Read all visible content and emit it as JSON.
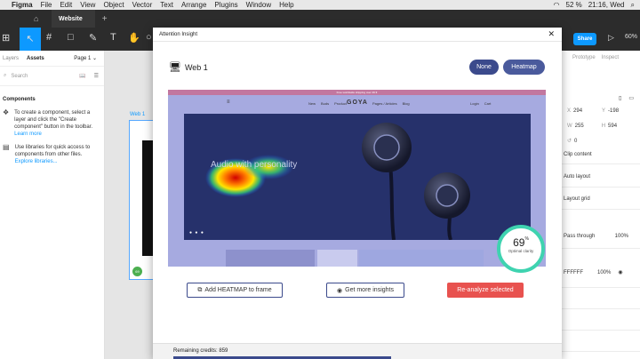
{
  "os": {
    "menus": [
      "Figma",
      "File",
      "Edit",
      "View",
      "Object",
      "Vector",
      "Text",
      "Arrange",
      "Plugins",
      "Window",
      "Help"
    ],
    "battery": "52 %",
    "clock": "21:16, Wed"
  },
  "tabbar": {
    "tab_label": "Website"
  },
  "toolbar": {
    "share_label": "Share",
    "zoom_label": "60%"
  },
  "left_panel": {
    "tabs": [
      "Layers",
      "Assets"
    ],
    "page_selector": "Page 1",
    "search_placeholder": "Search",
    "components_title": "Components",
    "create_text": "To create a component, select a layer and click the \"Create component\" button in the toolbar.",
    "learn_more": "Learn more",
    "libraries_text": "Use libraries for quick access to components from other files.",
    "explore_link": "Explore libraries..."
  },
  "canvas": {
    "frame_label": "Web 1",
    "frame_badge": "69"
  },
  "right_panel": {
    "tabs": [
      "Design",
      "Prototype",
      "Inspect"
    ],
    "x": "294",
    "y": "-198",
    "w": "255",
    "h": "594",
    "rotation": "0",
    "clip_content": "Clip content",
    "auto_layout": "Auto layout",
    "layout_grid": "Layout grid",
    "pass_through": "Pass through",
    "layer_opacity": "100%",
    "fill_hex": "FFFFFF",
    "fill_opacity": "100%"
  },
  "modal": {
    "title": "Attention Insight",
    "frame_name": "Web 1",
    "toggle_none": "None",
    "toggle_heatmap": "Heatmap",
    "add_heatmap_btn": "Add HEATMAP to frame",
    "more_insights_btn": "Get more insights",
    "reanalyze_btn": "Re-analyze selected",
    "score_value": "69",
    "score_unit": "%",
    "score_label": "Optimal clarity",
    "credits_label": "Remaining credits: 859"
  },
  "preview": {
    "top_strip": "Free worldwide shipping over 49 €",
    "logo": "GOYA",
    "nav_links": [
      "New",
      "Buds",
      "Product"
    ],
    "nav_links2": [
      "Pages / Articles",
      "Blog"
    ],
    "account_links": [
      "Login",
      "Cart"
    ],
    "hero_text": "Audio with personality",
    "hero_dots": "● ● ●"
  },
  "colors": {
    "accent": "#0d99ff",
    "modal_primary": "#3b4a8c",
    "danger": "#e8524f",
    "score_ring": "#3fd3b0"
  }
}
